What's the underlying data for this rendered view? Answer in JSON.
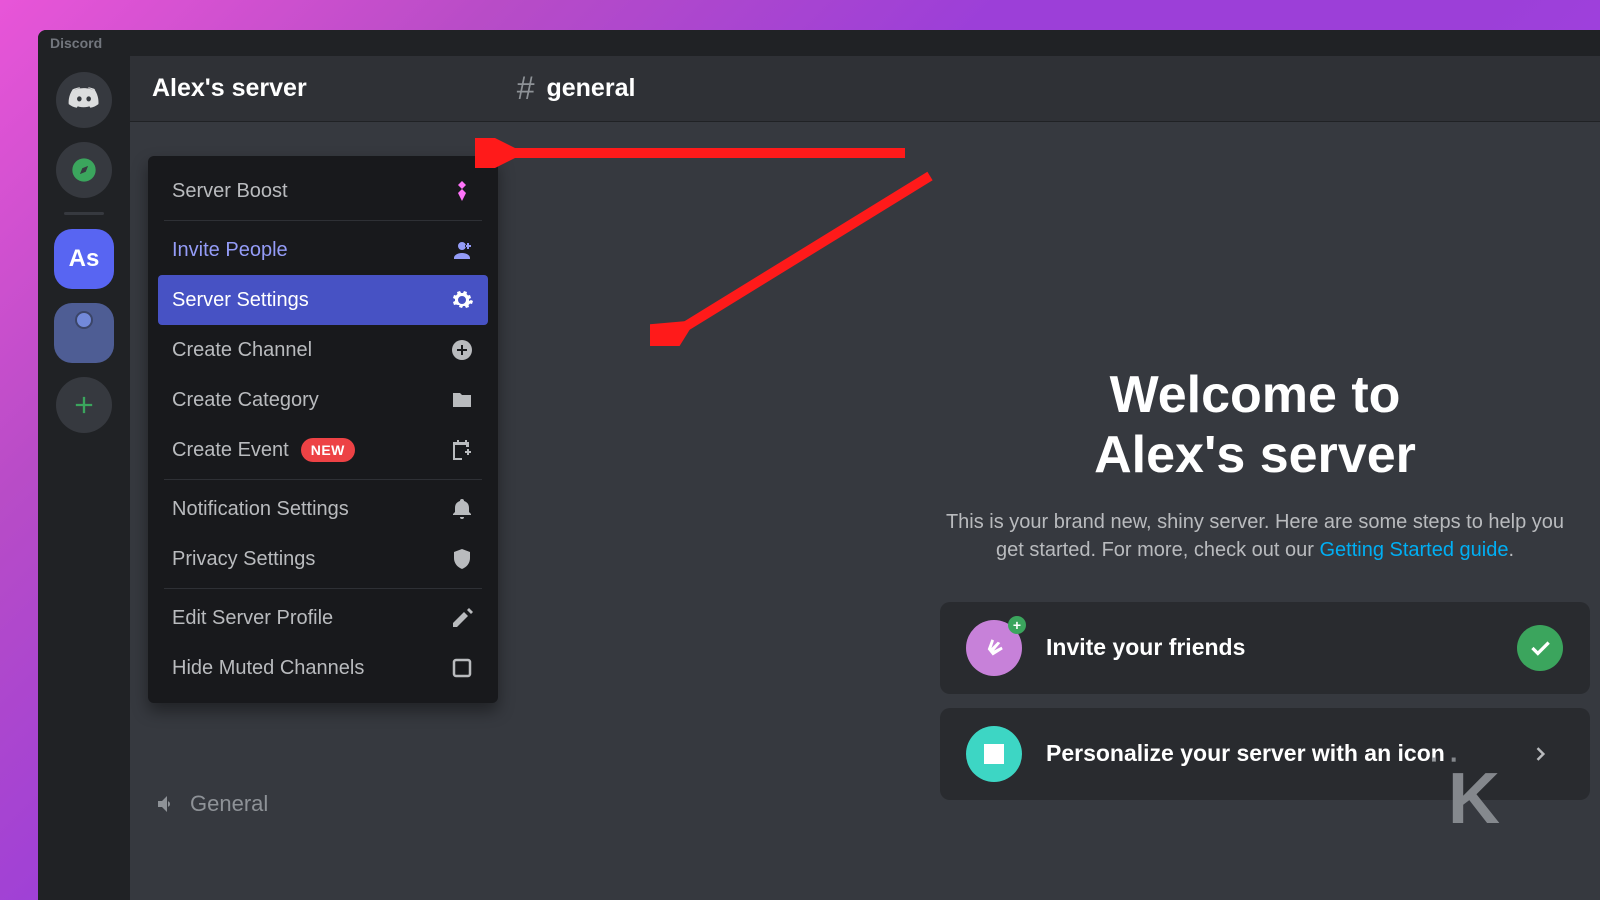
{
  "titlebar": {
    "appName": "Discord"
  },
  "rail": {
    "activeServerInitials": "As"
  },
  "header": {
    "serverName": "Alex's server",
    "channelName": "general"
  },
  "menu": {
    "items": [
      {
        "label": "Server Boost",
        "icon": "boost-icon",
        "variant": "default"
      },
      {
        "label": "Invite People",
        "icon": "invite-person-icon",
        "variant": "invite"
      },
      {
        "label": "Server Settings",
        "icon": "gear-icon",
        "variant": "selected"
      },
      {
        "label": "Create Channel",
        "icon": "plus-circle-icon",
        "variant": "default"
      },
      {
        "label": "Create Category",
        "icon": "folder-plus-icon",
        "variant": "default"
      },
      {
        "label": "Create Event",
        "icon": "calendar-plus-icon",
        "variant": "default",
        "badge": "NEW"
      },
      {
        "label": "Notification Settings",
        "icon": "bell-icon",
        "variant": "default"
      },
      {
        "label": "Privacy Settings",
        "icon": "shield-icon",
        "variant": "default"
      },
      {
        "label": "Edit Server Profile",
        "icon": "pencil-icon",
        "variant": "default"
      },
      {
        "label": "Hide Muted Channels",
        "icon": "square-icon",
        "variant": "default"
      }
    ]
  },
  "voiceChannelLabel": "General",
  "welcome": {
    "titleLine1": "Welcome to",
    "titleLine2": "Alex's server",
    "subPrefix": "This is your brand new, shiny server. Here are some steps to help you get started. For more, check out our ",
    "subLinkText": "Getting Started guide",
    "subSuffix": ".",
    "steps": [
      {
        "label": "Invite your friends",
        "done": true
      },
      {
        "label": "Personalize your server with an icon",
        "done": false
      }
    ]
  },
  "watermark": "K"
}
